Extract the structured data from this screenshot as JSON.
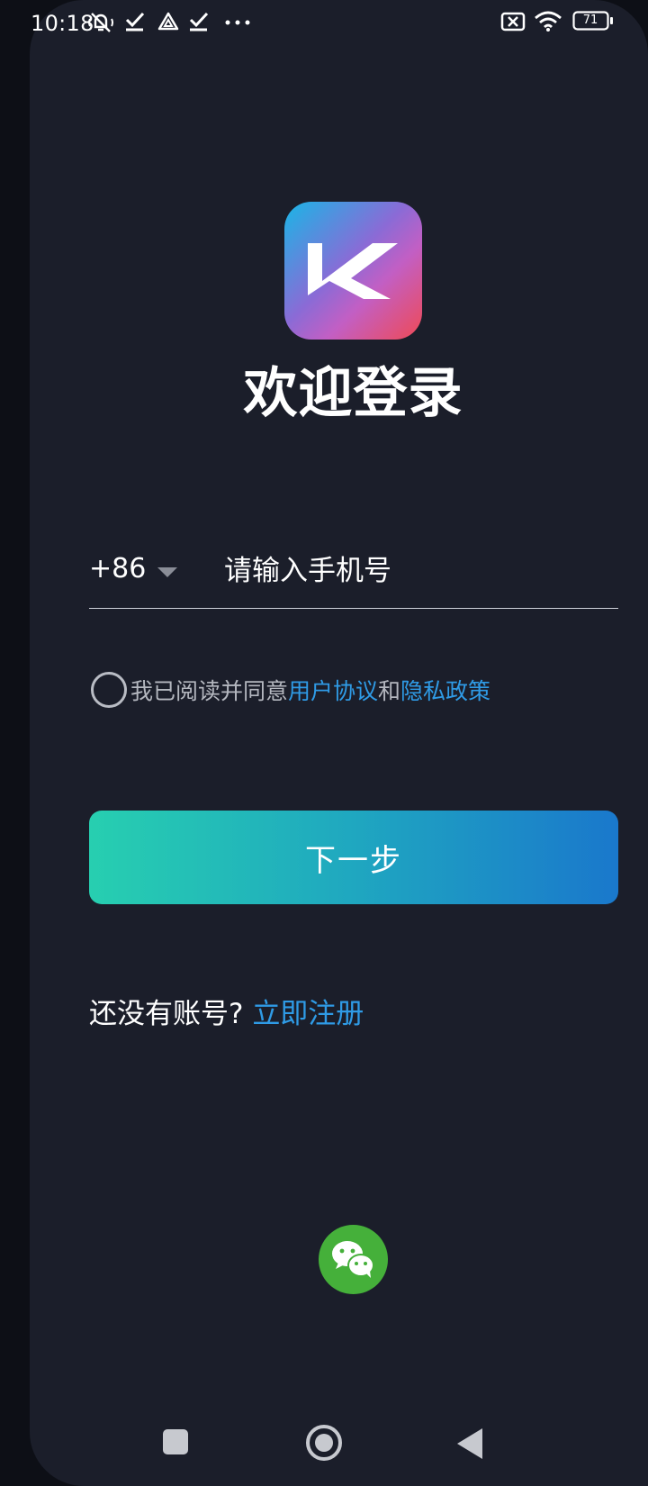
{
  "status_bar": {
    "time": "10:18",
    "icons": [
      "mute-notification-icon",
      "check-icon",
      "drive-icon",
      "check-icon",
      "more-dots-icon"
    ],
    "right_icons": [
      "no-sim-icon",
      "wifi-icon",
      "battery-icon"
    ],
    "battery_level": "71"
  },
  "login": {
    "logo_icon": "keep-app-logo",
    "title": "欢迎登录",
    "country_code": "+86",
    "phone_placeholder": "请输入手机号",
    "agree_prefix": "我已阅读并同意",
    "user_agreement": "用户协议",
    "and": "和",
    "privacy_policy": "隐私政策",
    "next_label": "下一步",
    "no_account": "还没有账号?",
    "register_label": "立即注册",
    "wechat_icon": "wechat-icon"
  },
  "colors": {
    "background": "#1b1e2a",
    "link": "#2f9be6",
    "button_start": "#27cfb0",
    "button_end": "#1a78cc",
    "wechat": "#45b03a"
  },
  "nav_bar": {
    "icons": [
      "recents-icon",
      "home-icon",
      "back-icon"
    ]
  }
}
